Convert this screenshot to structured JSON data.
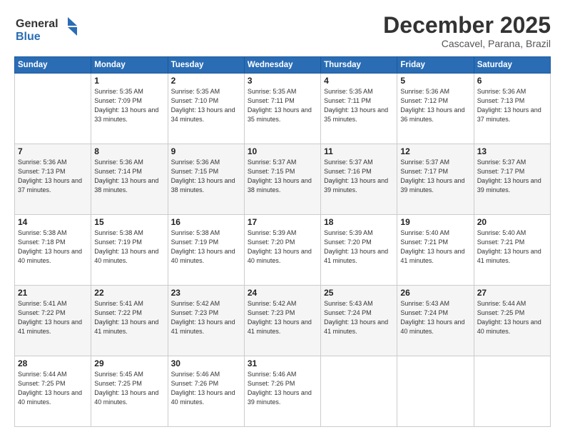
{
  "logo": {
    "line1": "General",
    "line2": "Blue"
  },
  "header": {
    "month": "December 2025",
    "location": "Cascavel, Parana, Brazil"
  },
  "weekdays": [
    "Sunday",
    "Monday",
    "Tuesday",
    "Wednesday",
    "Thursday",
    "Friday",
    "Saturday"
  ],
  "weeks": [
    [
      {
        "day": null,
        "sunrise": null,
        "sunset": null,
        "daylight": null
      },
      {
        "day": "1",
        "sunrise": "5:35 AM",
        "sunset": "7:09 PM",
        "daylight": "13 hours and 33 minutes."
      },
      {
        "day": "2",
        "sunrise": "5:35 AM",
        "sunset": "7:10 PM",
        "daylight": "13 hours and 34 minutes."
      },
      {
        "day": "3",
        "sunrise": "5:35 AM",
        "sunset": "7:11 PM",
        "daylight": "13 hours and 35 minutes."
      },
      {
        "day": "4",
        "sunrise": "5:35 AM",
        "sunset": "7:11 PM",
        "daylight": "13 hours and 35 minutes."
      },
      {
        "day": "5",
        "sunrise": "5:36 AM",
        "sunset": "7:12 PM",
        "daylight": "13 hours and 36 minutes."
      },
      {
        "day": "6",
        "sunrise": "5:36 AM",
        "sunset": "7:13 PM",
        "daylight": "13 hours and 37 minutes."
      }
    ],
    [
      {
        "day": "7",
        "sunrise": "5:36 AM",
        "sunset": "7:13 PM",
        "daylight": "13 hours and 37 minutes."
      },
      {
        "day": "8",
        "sunrise": "5:36 AM",
        "sunset": "7:14 PM",
        "daylight": "13 hours and 38 minutes."
      },
      {
        "day": "9",
        "sunrise": "5:36 AM",
        "sunset": "7:15 PM",
        "daylight": "13 hours and 38 minutes."
      },
      {
        "day": "10",
        "sunrise": "5:37 AM",
        "sunset": "7:15 PM",
        "daylight": "13 hours and 38 minutes."
      },
      {
        "day": "11",
        "sunrise": "5:37 AM",
        "sunset": "7:16 PM",
        "daylight": "13 hours and 39 minutes."
      },
      {
        "day": "12",
        "sunrise": "5:37 AM",
        "sunset": "7:17 PM",
        "daylight": "13 hours and 39 minutes."
      },
      {
        "day": "13",
        "sunrise": "5:37 AM",
        "sunset": "7:17 PM",
        "daylight": "13 hours and 39 minutes."
      }
    ],
    [
      {
        "day": "14",
        "sunrise": "5:38 AM",
        "sunset": "7:18 PM",
        "daylight": "13 hours and 40 minutes."
      },
      {
        "day": "15",
        "sunrise": "5:38 AM",
        "sunset": "7:19 PM",
        "daylight": "13 hours and 40 minutes."
      },
      {
        "day": "16",
        "sunrise": "5:38 AM",
        "sunset": "7:19 PM",
        "daylight": "13 hours and 40 minutes."
      },
      {
        "day": "17",
        "sunrise": "5:39 AM",
        "sunset": "7:20 PM",
        "daylight": "13 hours and 40 minutes."
      },
      {
        "day": "18",
        "sunrise": "5:39 AM",
        "sunset": "7:20 PM",
        "daylight": "13 hours and 41 minutes."
      },
      {
        "day": "19",
        "sunrise": "5:40 AM",
        "sunset": "7:21 PM",
        "daylight": "13 hours and 41 minutes."
      },
      {
        "day": "20",
        "sunrise": "5:40 AM",
        "sunset": "7:21 PM",
        "daylight": "13 hours and 41 minutes."
      }
    ],
    [
      {
        "day": "21",
        "sunrise": "5:41 AM",
        "sunset": "7:22 PM",
        "daylight": "13 hours and 41 minutes."
      },
      {
        "day": "22",
        "sunrise": "5:41 AM",
        "sunset": "7:22 PM",
        "daylight": "13 hours and 41 minutes."
      },
      {
        "day": "23",
        "sunrise": "5:42 AM",
        "sunset": "7:23 PM",
        "daylight": "13 hours and 41 minutes."
      },
      {
        "day": "24",
        "sunrise": "5:42 AM",
        "sunset": "7:23 PM",
        "daylight": "13 hours and 41 minutes."
      },
      {
        "day": "25",
        "sunrise": "5:43 AM",
        "sunset": "7:24 PM",
        "daylight": "13 hours and 41 minutes."
      },
      {
        "day": "26",
        "sunrise": "5:43 AM",
        "sunset": "7:24 PM",
        "daylight": "13 hours and 40 minutes."
      },
      {
        "day": "27",
        "sunrise": "5:44 AM",
        "sunset": "7:25 PM",
        "daylight": "13 hours and 40 minutes."
      }
    ],
    [
      {
        "day": "28",
        "sunrise": "5:44 AM",
        "sunset": "7:25 PM",
        "daylight": "13 hours and 40 minutes."
      },
      {
        "day": "29",
        "sunrise": "5:45 AM",
        "sunset": "7:25 PM",
        "daylight": "13 hours and 40 minutes."
      },
      {
        "day": "30",
        "sunrise": "5:46 AM",
        "sunset": "7:26 PM",
        "daylight": "13 hours and 40 minutes."
      },
      {
        "day": "31",
        "sunrise": "5:46 AM",
        "sunset": "7:26 PM",
        "daylight": "13 hours and 39 minutes."
      },
      {
        "day": null,
        "sunrise": null,
        "sunset": null,
        "daylight": null
      },
      {
        "day": null,
        "sunrise": null,
        "sunset": null,
        "daylight": null
      },
      {
        "day": null,
        "sunrise": null,
        "sunset": null,
        "daylight": null
      }
    ]
  ],
  "labels": {
    "sunrise": "Sunrise:",
    "sunset": "Sunset:",
    "daylight": "Daylight:"
  }
}
